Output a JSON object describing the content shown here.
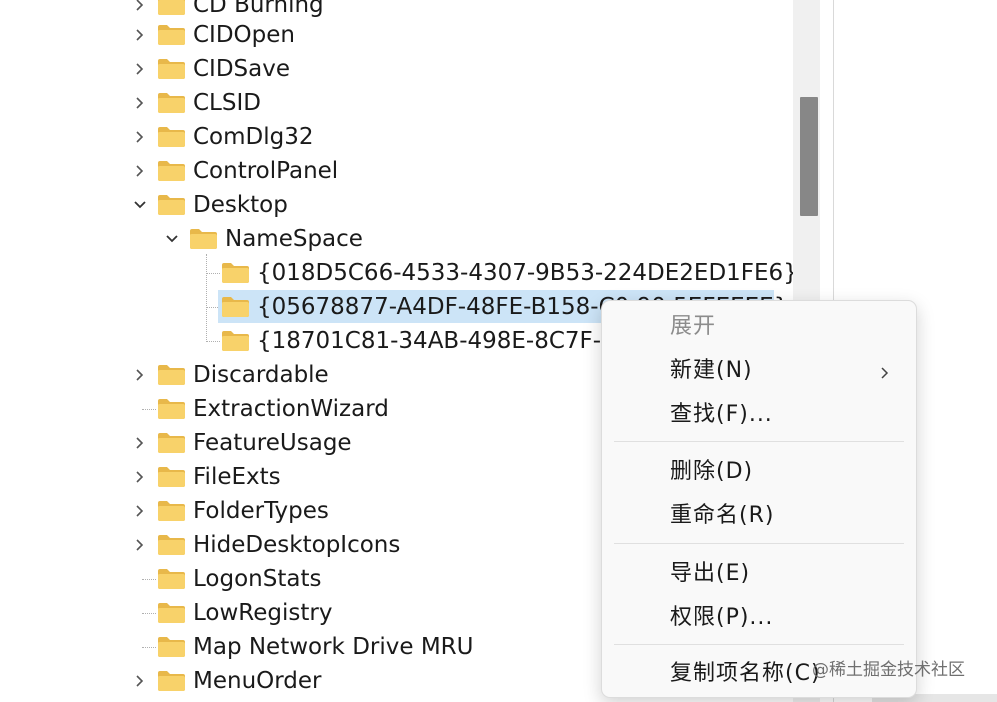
{
  "tree": {
    "rows": [
      {
        "label": "CD Burning",
        "expander": "chevron-right"
      },
      {
        "label": "CIDOpen",
        "expander": "chevron-right"
      },
      {
        "label": "CIDSave",
        "expander": "chevron-right"
      },
      {
        "label": "CLSID",
        "expander": "chevron-right"
      },
      {
        "label": "ComDlg32",
        "expander": "chevron-right"
      },
      {
        "label": "ControlPanel",
        "expander": "chevron-right"
      },
      {
        "label": "Desktop",
        "expander": "chevron-down"
      },
      {
        "label": "NameSpace",
        "expander": "chevron-down"
      },
      {
        "label": "{018D5C66-4533-4307-9B53-224DE2ED1FE6}",
        "expander": "none"
      },
      {
        "label": "{05678877-A4DF-48FE-B158-C0 90 5EFEEEE}",
        "expander": "none",
        "selected": true
      },
      {
        "label": "{18701C81-34AB-498E-8C7F-5",
        "expander": "none"
      },
      {
        "label": "Discardable",
        "expander": "chevron-right"
      },
      {
        "label": "ExtractionWizard",
        "expander": "none"
      },
      {
        "label": "FeatureUsage",
        "expander": "chevron-right"
      },
      {
        "label": "FileExts",
        "expander": "chevron-right"
      },
      {
        "label": "FolderTypes",
        "expander": "chevron-right"
      },
      {
        "label": "HideDesktopIcons",
        "expander": "chevron-right"
      },
      {
        "label": "LogonStats",
        "expander": "none"
      },
      {
        "label": "LowRegistry",
        "expander": "none"
      },
      {
        "label": "Map Network Drive MRU",
        "expander": "none"
      },
      {
        "label": "MenuOrder",
        "expander": "chevron-right"
      }
    ]
  },
  "context_menu": {
    "items": [
      {
        "label": "展开",
        "disabled": true
      },
      {
        "label": "新建(N)",
        "has_submenu": true
      },
      {
        "label": "查找(F)..."
      },
      {
        "label": "删除(D)"
      },
      {
        "label": "重命名(R)"
      },
      {
        "label": "导出(E)"
      },
      {
        "label": "权限(P)..."
      },
      {
        "label": "复制项名称(C)"
      }
    ]
  },
  "watermark": "@稀土掘金技术社区",
  "colors": {
    "folder_yellow": "#f8d26a",
    "folder_tab": "#e8b84a",
    "selection": "#cce4f7",
    "menu_bg": "#f9f9f9",
    "scroll_thumb": "#878787"
  }
}
